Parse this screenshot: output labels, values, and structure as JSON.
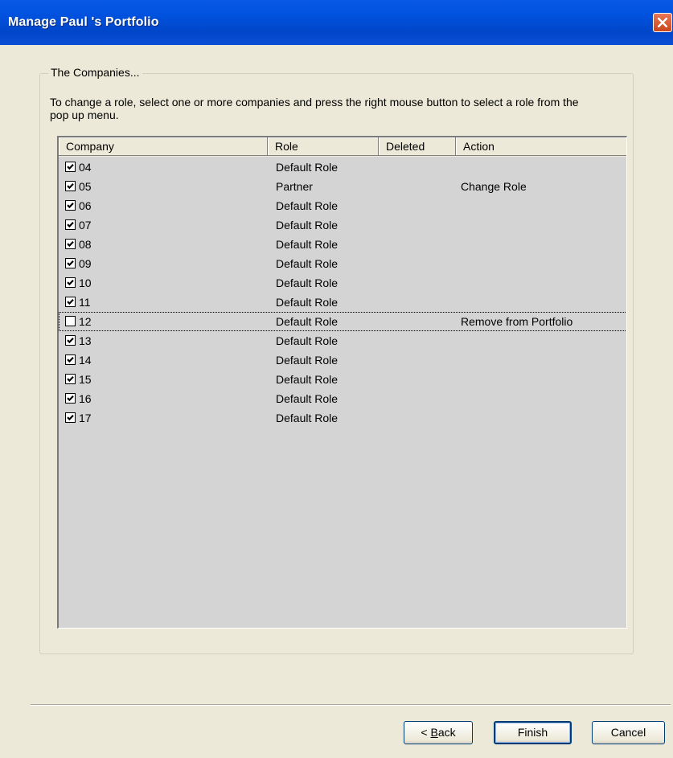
{
  "window": {
    "title": "Manage Paul 's Portfolio"
  },
  "group": {
    "label": "The Companies...",
    "instructions": "To change a role, select one or more companies and press the right mouse button to select a role from the pop up menu."
  },
  "list": {
    "columns": [
      "Company",
      "Role",
      "Deleted",
      "Action"
    ],
    "rows": [
      {
        "checked": true,
        "company": "04",
        "role": "Default Role",
        "deleted": "",
        "action": ""
      },
      {
        "checked": true,
        "company": "05",
        "role": "Partner",
        "deleted": "",
        "action": "Change Role"
      },
      {
        "checked": true,
        "company": "06",
        "role": "Default Role",
        "deleted": "",
        "action": ""
      },
      {
        "checked": true,
        "company": "07",
        "role": "Default Role",
        "deleted": "",
        "action": ""
      },
      {
        "checked": true,
        "company": "08",
        "role": "Default Role",
        "deleted": "",
        "action": ""
      },
      {
        "checked": true,
        "company": "09",
        "role": "Default Role",
        "deleted": "",
        "action": ""
      },
      {
        "checked": true,
        "company": "10",
        "role": "Default Role",
        "deleted": "",
        "action": ""
      },
      {
        "checked": true,
        "company": "11",
        "role": "Default Role",
        "deleted": "",
        "action": ""
      },
      {
        "checked": false,
        "company": "12",
        "role": "Default Role",
        "deleted": "",
        "action": "Remove from Portfolio",
        "focused": true
      },
      {
        "checked": true,
        "company": "13",
        "role": "Default Role",
        "deleted": "",
        "action": ""
      },
      {
        "checked": true,
        "company": "14",
        "role": "Default Role",
        "deleted": "",
        "action": ""
      },
      {
        "checked": true,
        "company": "15",
        "role": "Default Role",
        "deleted": "",
        "action": ""
      },
      {
        "checked": true,
        "company": "16",
        "role": "Default Role",
        "deleted": "",
        "action": ""
      },
      {
        "checked": true,
        "company": "17",
        "role": "Default Role",
        "deleted": "",
        "action": ""
      }
    ]
  },
  "buttons": {
    "back_prefix": "< ",
    "back_accel": "B",
    "back_rest": "ack",
    "finish": "Finish",
    "cancel": "Cancel"
  },
  "colors": {
    "titlebar": "#0053e0",
    "dialog": "#ece9d8",
    "list_bg": "#d4d4d4",
    "close_button": "#c9471c"
  },
  "icons": {
    "close": "close-icon",
    "checkbox": "checkmark-icon"
  }
}
